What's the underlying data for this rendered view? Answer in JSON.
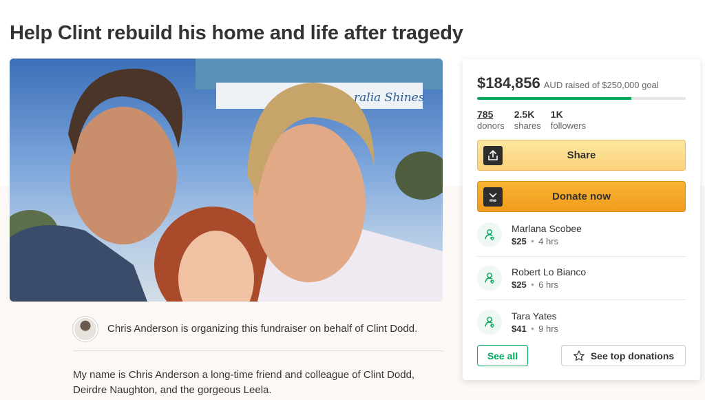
{
  "page": {
    "title": "Help Clint rebuild his home and life after tragedy"
  },
  "hero": {
    "banner_text": "ralia Shines"
  },
  "organizer": {
    "text": "Chris Anderson is organizing this fundraiser on behalf of Clint Dodd."
  },
  "story": {
    "text": "My name is Chris Anderson a long-time friend and colleague of Clint Dodd, Deirdre Naughton, and the gorgeous Leela."
  },
  "campaign": {
    "raised_amount": "$184,856",
    "goal_text": "AUD raised of $250,000 goal",
    "progress_fraction": 0.739,
    "stats": [
      {
        "num": "785",
        "label": "donors"
      },
      {
        "num": "2.5K",
        "label": "shares"
      },
      {
        "num": "1K",
        "label": "followers"
      }
    ],
    "share_label": "Share",
    "donate_label": "Donate now",
    "donations": [
      {
        "name": "Marlana Scobee",
        "amount": "$25",
        "time": "4 hrs"
      },
      {
        "name": "Robert Lo Bianco",
        "amount": "$25",
        "time": "6 hrs"
      },
      {
        "name": "Tara Yates",
        "amount": "$41",
        "time": "9 hrs"
      }
    ],
    "see_all_label": "See all",
    "top_donations_label": "See top donations"
  },
  "colors": {
    "accent_green": "#02a95c",
    "donate_orange": "#f4a62a",
    "share_yellow": "#fcd98a"
  },
  "icons": {
    "share": "share-upload-icon",
    "donate": "gofundme-logo-icon",
    "donor": "donor-hand-heart-icon",
    "star": "star-outline-icon"
  }
}
